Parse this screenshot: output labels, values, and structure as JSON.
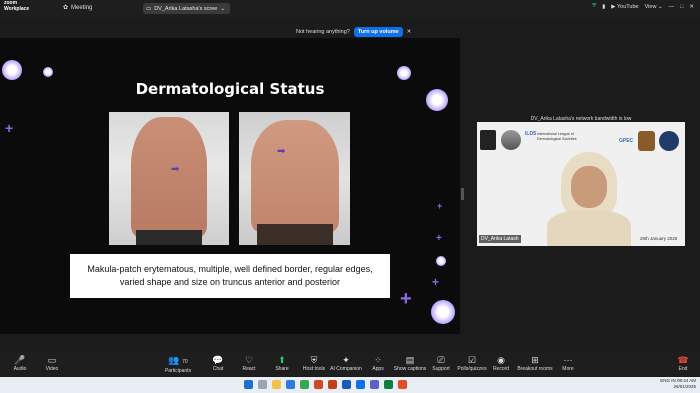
{
  "app": {
    "brand_line1": "zoom",
    "brand_line2": "Workplace",
    "meeting_label": "Meeting",
    "screen_share_label": "DV_Arika Latasha's scree"
  },
  "topbar": {
    "youtube_label": "YouTube",
    "view_label": "View"
  },
  "notification": {
    "text": "Not hearing anything?",
    "button": "Turn up volume"
  },
  "slide": {
    "title": "Dermatological Status",
    "caption": "Makula-patch erytematous, multiple, well defined border, regular edges, varied shape and size on truncus anterior and posterior"
  },
  "video": {
    "bandwidth_notice": "DV_Arika Latasha's network bandwidth is low",
    "participant_name": "DV_Arika Latash",
    "date_text": "26th January 2025",
    "event_name": "International League of Dermatological Societies",
    "logo_ilds": "ILDS",
    "logo_gpec": "GPEC"
  },
  "toolbar": {
    "items": [
      {
        "label": "Audio",
        "icon": "microphone-muted-icon"
      },
      {
        "label": "Video",
        "icon": "camera-icon"
      },
      {
        "label": "Participants",
        "icon": "people-icon",
        "count": "70"
      },
      {
        "label": "Chat",
        "icon": "chat-icon"
      },
      {
        "label": "React",
        "icon": "heart-icon"
      },
      {
        "label": "Share",
        "icon": "share-icon"
      },
      {
        "label": "Host tools",
        "icon": "shield-icon"
      },
      {
        "label": "AI Companion",
        "icon": "sparkle-icon"
      },
      {
        "label": "Apps",
        "icon": "apps-icon"
      },
      {
        "label": "Show captions",
        "icon": "captions-icon"
      },
      {
        "label": "Support",
        "icon": "support-icon"
      },
      {
        "label": "Polls/quizzes",
        "icon": "polls-icon"
      },
      {
        "label": "Record",
        "icon": "record-icon"
      },
      {
        "label": "Breakout rooms",
        "icon": "grid-icon"
      },
      {
        "label": "More",
        "icon": "more-icon"
      }
    ],
    "end_label": "End"
  },
  "tray": {
    "lang": "ENG",
    "region": "IN",
    "time": "08:44 AM",
    "date": "26/01/2025"
  }
}
